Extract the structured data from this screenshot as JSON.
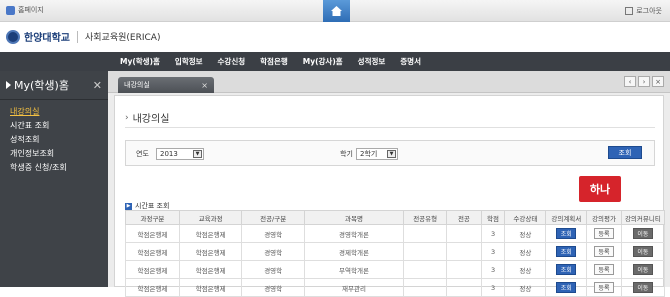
{
  "topbar": {
    "site_label": "홈페이지",
    "logout_label": "로그아웃"
  },
  "header": {
    "university": "한양대학교",
    "school": "사회교육원(ERICA)"
  },
  "nav": {
    "items": [
      "My(학생)홈",
      "입학정보",
      "수강신청",
      "학점은행",
      "My(강사)홈",
      "성적정보",
      "증명서"
    ]
  },
  "sidebar": {
    "title": "My(학생)홈",
    "items": [
      "내강의실",
      "시간표 조회",
      "성적조회",
      "개인정보조회",
      "학생증 신청/조회"
    ]
  },
  "tab": {
    "label": "내강의실"
  },
  "page": {
    "title": "내강의실"
  },
  "search": {
    "year_label": "연도",
    "year_value": "2013",
    "term_label": "학기",
    "term_value": "2학기",
    "button": "조회"
  },
  "annotation": "하나",
  "section": {
    "title": "시간표 조회"
  },
  "table": {
    "headers": [
      "과정구분",
      "교육과정",
      "전공/구분",
      "과목명",
      "전공유형",
      "전공",
      "학점",
      "수강상태",
      "강의계획서",
      "강의평가",
      "강의커뮤니티"
    ],
    "rows": [
      {
        "process": "학점은행제",
        "course": "학점은행제",
        "major": "경영학",
        "subject": "경영학개론",
        "type": "",
        "maj": "",
        "credit": "3",
        "status": "정상",
        "plan": "조회",
        "eval": "등록",
        "community": "이동"
      },
      {
        "process": "학점은행제",
        "course": "학점은행제",
        "major": "경영학",
        "subject": "경제학개론",
        "type": "",
        "maj": "",
        "credit": "3",
        "status": "정상",
        "plan": "조회",
        "eval": "등록",
        "community": "이동"
      },
      {
        "process": "학점은행제",
        "course": "학점은행제",
        "major": "경영학",
        "subject": "무역학개론",
        "type": "",
        "maj": "",
        "credit": "3",
        "status": "정상",
        "plan": "조회",
        "eval": "등록",
        "community": "이동"
      },
      {
        "process": "학점은행제",
        "course": "학점은행제",
        "major": "경영학",
        "subject": "재무관리",
        "type": "",
        "maj": "",
        "credit": "3",
        "status": "정상",
        "plan": "조회",
        "eval": "등록",
        "community": "이동"
      }
    ]
  },
  "colors": {
    "accent": "#2e63b5",
    "highlight": "#d6242b",
    "sidebar_bg": "#3f4348",
    "active_menu": "#f5c242"
  }
}
